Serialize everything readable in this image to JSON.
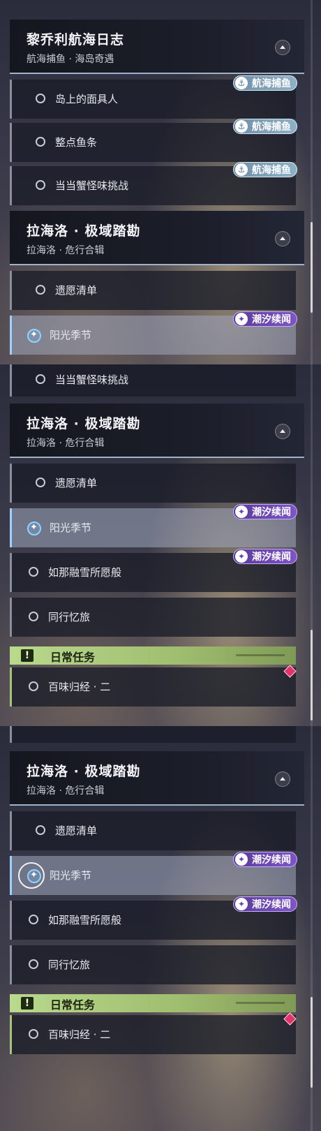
{
  "panels": [
    {
      "header1": {
        "title": "黎乔利航海日志",
        "subtitle": "航海捕鱼 · 海岛奇遇"
      },
      "items1": [
        {
          "label": "岛上的面具人",
          "badge": "航海捕鱼"
        },
        {
          "label": "整点鱼条",
          "badge": "航海捕鱼"
        },
        {
          "label": "当当蟹怪味挑战",
          "badge": "航海捕鱼"
        }
      ],
      "header2": {
        "title": "拉海洛 · 极域踏勘",
        "subtitle": "拉海洛 · 危行合辑"
      },
      "items2": [
        {
          "label": "遗愿清单"
        },
        {
          "label": "阳光季节",
          "badge": "潮汐续闻"
        }
      ]
    },
    {
      "top_item": {
        "label": "当当蟹怪味挑战"
      },
      "header": {
        "title": "拉海洛 · 极域踏勘",
        "subtitle": "拉海洛 · 危行合辑"
      },
      "items": [
        {
          "label": "遗愿清单"
        },
        {
          "label": "阳光季节",
          "badge": "潮汐续闻"
        },
        {
          "label": "如那融雪所愿般",
          "badge": "潮汐续闻"
        },
        {
          "label": "同行忆旅"
        }
      ],
      "daily": {
        "title": "日常任务",
        "items": [
          {
            "label": "百味归经 · 二"
          }
        ]
      }
    },
    {
      "header": {
        "title": "拉海洛 · 极域踏勘",
        "subtitle": "拉海洛 · 危行合辑"
      },
      "items": [
        {
          "label": "遗愿清单"
        },
        {
          "label": "阳光季节",
          "badge": "潮汐续闻"
        },
        {
          "label": "如那融雪所愿般",
          "badge": "潮汐续闻"
        },
        {
          "label": "同行忆旅"
        }
      ],
      "daily": {
        "title": "日常任务",
        "items": [
          {
            "label": "百味归经 · 二"
          }
        ]
      }
    }
  ],
  "icons": {
    "collapse": "chevron-up-icon",
    "radio": "radio-circle-icon",
    "active": "sparkle-target-icon",
    "daily": "exclamation-icon",
    "priority": "diamond-icon"
  },
  "colors": {
    "tide_badge": "#7f55c9",
    "fish_badge": "#8fb1c6",
    "daily_bar": "#b9d98c",
    "active_accent": "#9fd0ff",
    "priority": "#e3336b"
  }
}
